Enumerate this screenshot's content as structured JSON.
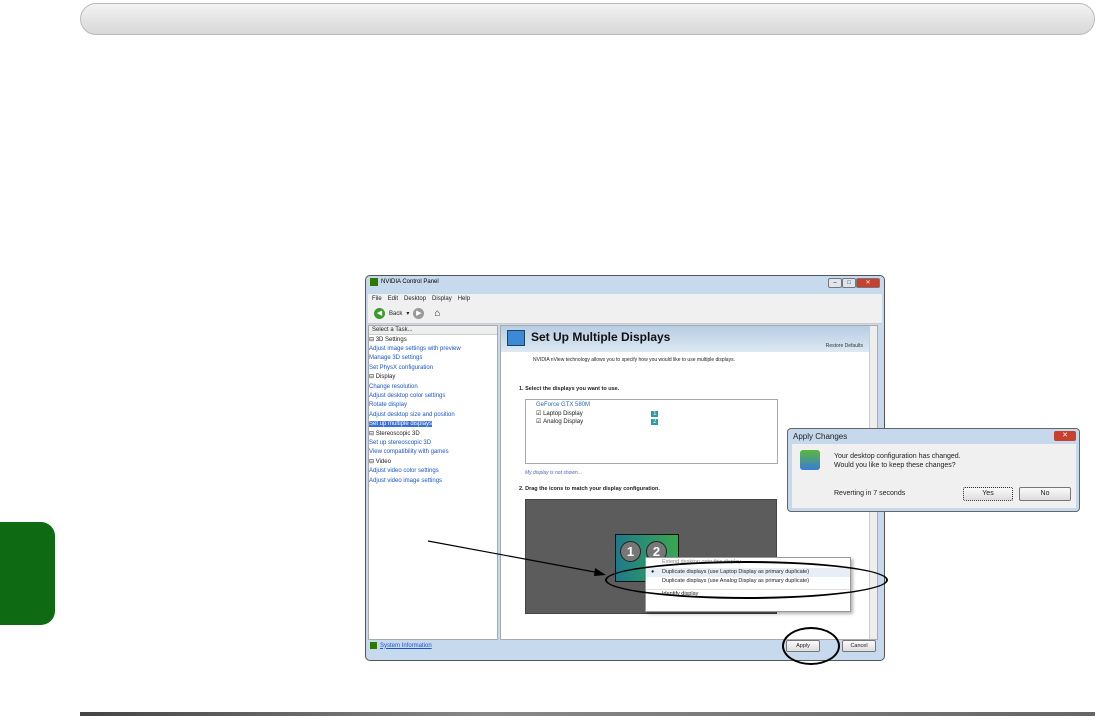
{
  "window": {
    "title": "NVIDIA Control Panel",
    "menu": [
      "File",
      "Edit",
      "Desktop",
      "Display",
      "Help"
    ],
    "back_label": "Back"
  },
  "sidebar": {
    "header": "Select a Task...",
    "tree": [
      {
        "label": "3D Settings",
        "type": "cat"
      },
      {
        "label": "Adjust image settings with preview",
        "type": "lnk"
      },
      {
        "label": "Manage 3D settings",
        "type": "lnk"
      },
      {
        "label": "Set PhysX configuration",
        "type": "lnk"
      },
      {
        "label": "Display",
        "type": "cat"
      },
      {
        "label": "Change resolution",
        "type": "lnk"
      },
      {
        "label": "Adjust desktop color settings",
        "type": "lnk"
      },
      {
        "label": "Rotate display",
        "type": "lnk"
      },
      {
        "label": "Adjust desktop size and position",
        "type": "lnk"
      },
      {
        "label": "Set up multiple displays",
        "type": "lnk sel"
      },
      {
        "label": "Stereoscopic 3D",
        "type": "cat"
      },
      {
        "label": "Set up stereoscopic 3D",
        "type": "lnk"
      },
      {
        "label": "View compatibility with games",
        "type": "lnk"
      },
      {
        "label": "Video",
        "type": "cat"
      },
      {
        "label": "Adjust video color settings",
        "type": "lnk"
      },
      {
        "label": "Adjust video image settings",
        "type": "lnk"
      }
    ],
    "system_info": "System Information"
  },
  "main": {
    "title": "Set Up Multiple Displays",
    "restore": "Restore Defaults",
    "description": "NVIDIA nView technology allows you to specify how you would like to use multiple displays.",
    "step1": "1. Select the displays you want to use.",
    "gpu": "GeForce GTX 580M",
    "displays": [
      {
        "label": "Laptop Display",
        "num": "1",
        "checked": true
      },
      {
        "label": "Analog Display",
        "num": "2",
        "checked": true
      }
    ],
    "not_shown": "My display is not shown...",
    "step2": "2. Drag the icons to match your display configuration.",
    "monitors": [
      "1",
      "2"
    ],
    "apply": "Apply",
    "cancel": "Cancel"
  },
  "context_menu": {
    "items": [
      "Extend desktop onto this display",
      "Duplicate displays (use Laptop Display as primary duplicate)",
      "Duplicate displays (use Analog Display as primary duplicate)",
      "Identify display"
    ],
    "selected": 1
  },
  "dialog": {
    "title": "Apply Changes",
    "line1": "Your desktop configuration has changed.",
    "line2": "Would you like to keep these changes?",
    "countdown": "Reverting in 7 seconds",
    "yes": "Yes",
    "no": "No"
  },
  "colors": {
    "tab": "#0f6a14",
    "link": "#1a55c8"
  }
}
